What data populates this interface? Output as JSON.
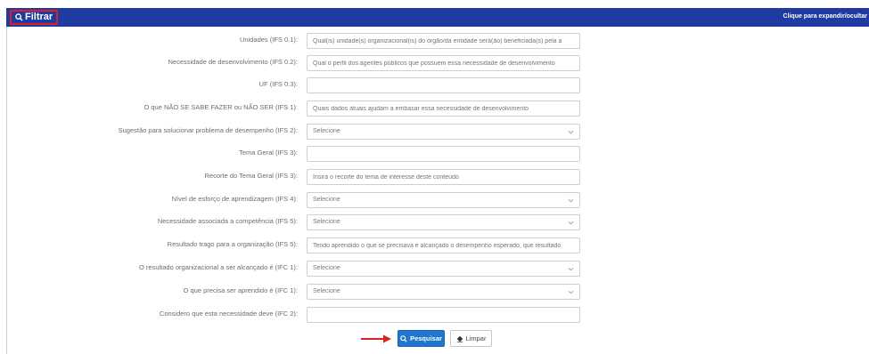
{
  "header": {
    "title": "Filtrar",
    "toggle_label": "Clique para expandir/ocultar"
  },
  "fields": [
    {
      "label": "Unidades (IFS 0.1):",
      "type": "text",
      "placeholder": "Qual(is) unidade(s) organizacional(is) do órgão/da entidade será(ão) beneficiada(s) pela a"
    },
    {
      "label": "Necessidade de desenvolvimento (IFS 0.2):",
      "type": "text",
      "placeholder": "Qual o perfil dos agentes públicos que possuem essa necessidade de desenvolvimento"
    },
    {
      "label": "UF (IFS 0.3):",
      "type": "text",
      "placeholder": ""
    },
    {
      "label": "O que NÃO SE SABE FAZER ou NÃO SER (IFS 1):",
      "type": "text",
      "placeholder": "Quais dados atuais ajudam a embasar essa necessidade de desenvolvimento"
    },
    {
      "label": "Sugestão para solucionar problema de desempenho (IFS 2):",
      "type": "select",
      "value": "Selecione"
    },
    {
      "label": "Tema Geral (IFS 3):",
      "type": "text",
      "placeholder": ""
    },
    {
      "label": "Recorte do Tema Geral (IFS 3):",
      "type": "text",
      "placeholder": "Insira o recorte do tema de interesse deste conteúdo"
    },
    {
      "label": "Nível de esforço de aprendizagem (IFS 4):",
      "type": "select",
      "value": "Selecione"
    },
    {
      "label": "Necessidade associada a competência (IFS 5):",
      "type": "select",
      "value": "Selecione"
    },
    {
      "label": "Resultado trago para a organização (IFS 5):",
      "type": "text",
      "placeholder": "Tendo aprendido o que se precisava e alcançado o desempenho esperado, que resultado"
    },
    {
      "label": "O resultado organizacional a ser alcançado é (IFC 1):",
      "type": "select",
      "value": "Selecione"
    },
    {
      "label": "O que precisa ser aprendido é (IFC 1):",
      "type": "select",
      "value": "Selecione"
    },
    {
      "label": "Considero que esta necessidade deve (IFC 2):",
      "type": "text",
      "placeholder": ""
    }
  ],
  "buttons": {
    "search_label": "Pesquisar",
    "clear_label": "Limpar"
  },
  "colors": {
    "header_bg": "#1f3aa0",
    "primary_button": "#1e76cf",
    "highlight": "#e02020"
  },
  "icons": {
    "search": "search-icon",
    "clear": "eraser-icon",
    "chevron": "chevron-down-icon",
    "annotation_arrow": "arrow-right-icon"
  }
}
